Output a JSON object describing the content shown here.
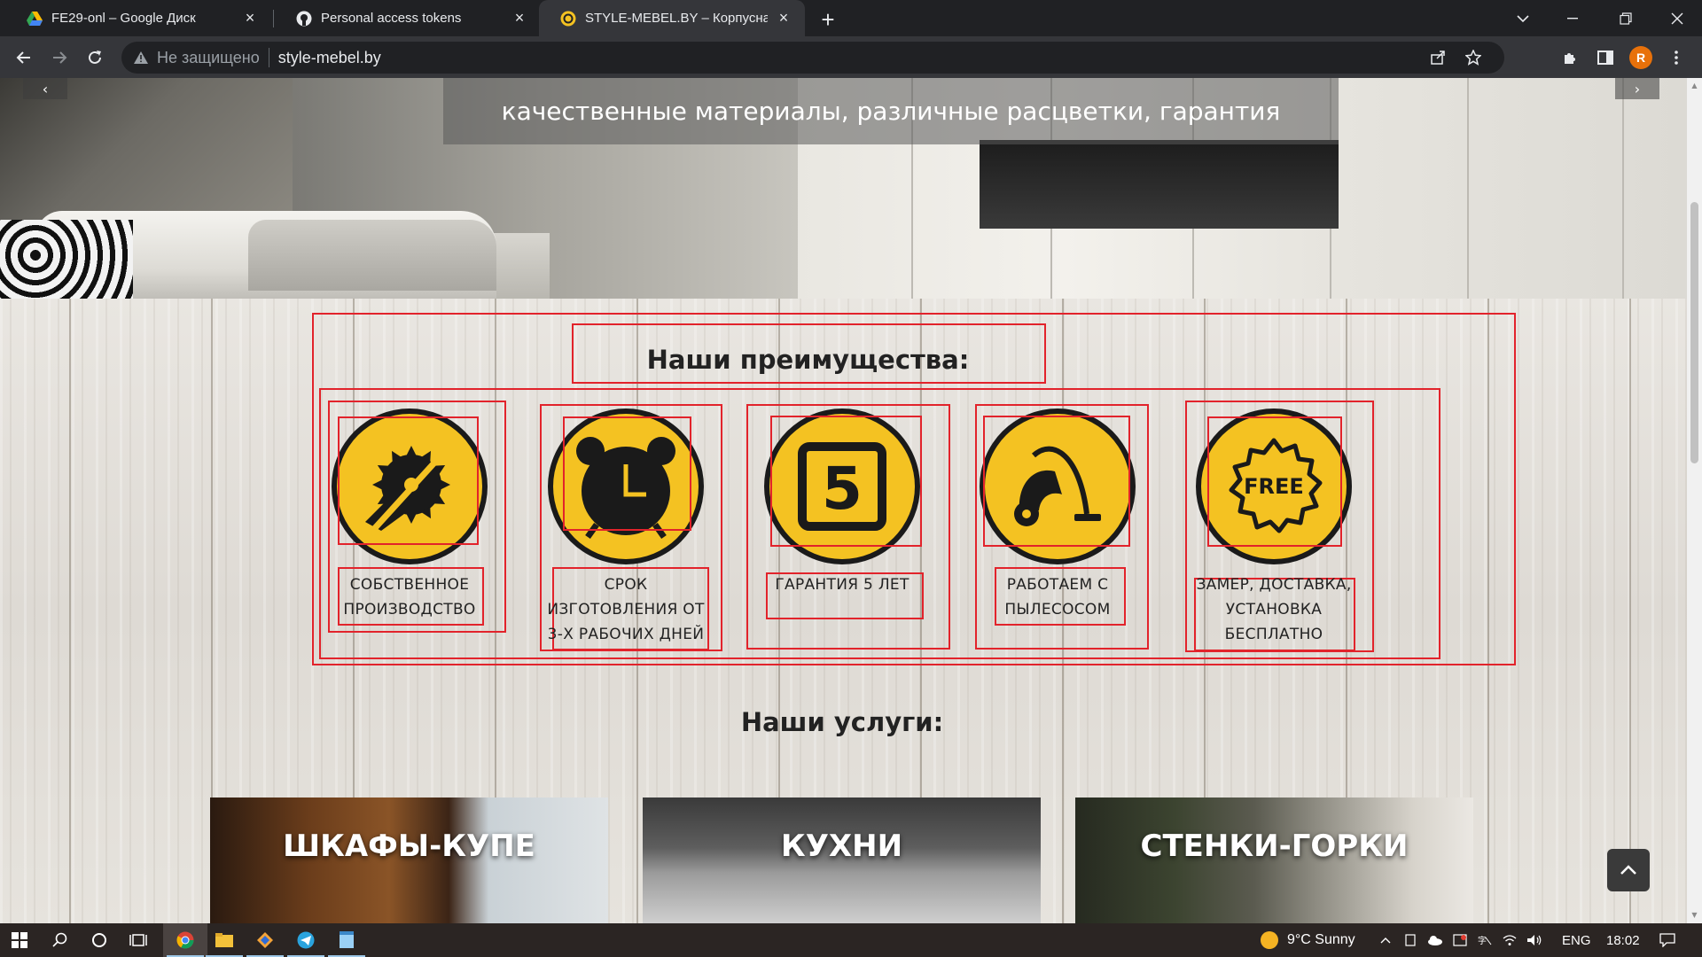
{
  "browser": {
    "tabs": [
      {
        "title": "FE29-onl – Google Диск",
        "favicon": "google-drive-icon",
        "active": false
      },
      {
        "title": "Personal access tokens",
        "favicon": "github-icon",
        "active": false
      },
      {
        "title": "STYLE-MEBEL.BY – Корпусная ме",
        "favicon": "style-mebel-icon",
        "active": true
      }
    ],
    "security_label": "Не защищено",
    "url": "style-mebel.by",
    "profile_initial": "R"
  },
  "page": {
    "hero_caption": "качественные материалы, различные расцветки, гарантия",
    "advantages_title": "Наши преимущества:",
    "advantages": [
      {
        "icon": "saw-blade-icon",
        "label": "СОБСТВЕННОЕ ПРОИЗВОДСТВО"
      },
      {
        "icon": "alarm-clock-icon",
        "label": "СРОК ИЗГОТОВЛЕНИЯ ОТ 3-Х РАБОЧИХ ДНЕЙ"
      },
      {
        "icon": "five-years-icon",
        "label": "ГАРАНТИЯ 5 ЛЕТ",
        "icon_text": "5"
      },
      {
        "icon": "vacuum-cleaner-icon",
        "label": "РАБОТАЕМ С ПЫЛЕСОСОМ"
      },
      {
        "icon": "free-badge-icon",
        "label": "ЗАМЕР, ДОСТАВКА, УСТАНОВКА БЕСПЛАТНО",
        "icon_text": "FREE"
      }
    ],
    "services_title": "Наши услуги:",
    "services": [
      {
        "label": "ШКАФЫ-КУПЕ"
      },
      {
        "label": "КУХНИ"
      },
      {
        "label": "СТЕНКИ-ГОРКИ"
      }
    ],
    "outline_color": "#e2232b",
    "accent_yellow": "#f4c222"
  },
  "taskbar": {
    "weather": "9°C  Sunny",
    "language": "ENG",
    "time": "18:02"
  }
}
